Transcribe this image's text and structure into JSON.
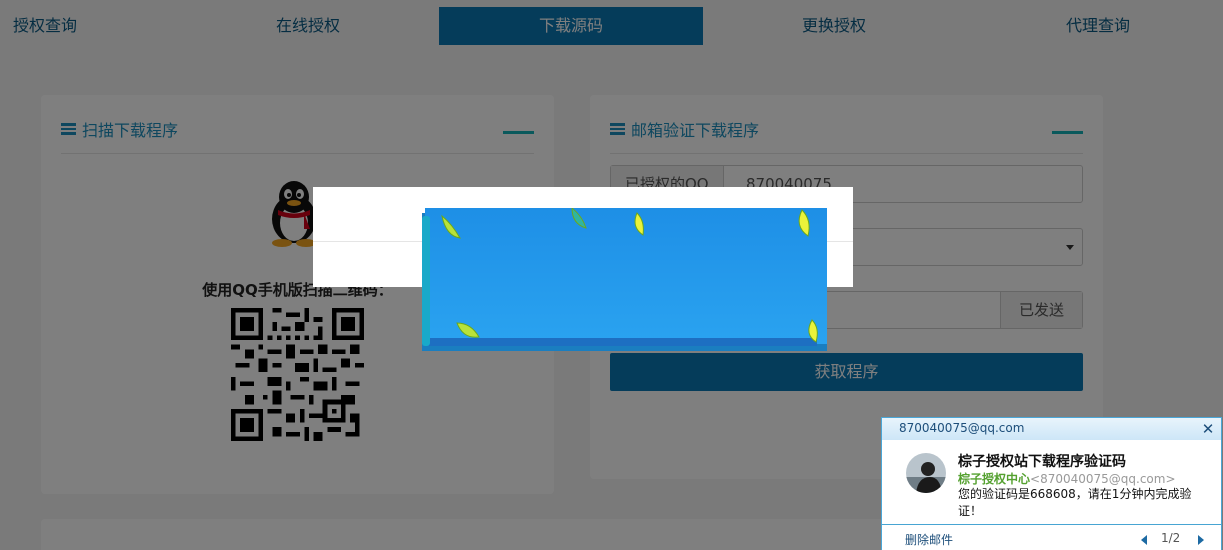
{
  "nav": {
    "tabs": [
      {
        "label": "授权查询",
        "active": false
      },
      {
        "label": "在线授权",
        "active": false
      },
      {
        "label": "下载源码",
        "active": true
      },
      {
        "label": "更换授权",
        "active": false
      },
      {
        "label": "代理查询",
        "active": false
      }
    ]
  },
  "scan_card": {
    "title": "扫描下载程序",
    "qr_label": "使用QQ手机版扫描二维码："
  },
  "email_card": {
    "title": "邮箱验证下载程序",
    "qq_field": {
      "label": "已授权的QQ",
      "value": "870040075"
    },
    "send_button": "已发送",
    "get_button": "获取程序"
  },
  "notification": {
    "from_email": "870040075@qq.com",
    "subject": "棕子授权站下载程序验证码",
    "sender_name": "棕子授权中心",
    "sender_email": "<870040075@qq.com>",
    "body": "您的验证码是668608，请在1分钟内完成验证！",
    "delete_label": "删除邮件",
    "pager": "1/2"
  },
  "icons": [
    "card-list-icon",
    "qq-penguin-icon",
    "qr-code",
    "close-icon",
    "dropdown-caret-icon",
    "prev-arrow-icon",
    "next-arrow-icon"
  ],
  "colors": {
    "accent": "#0b78b5",
    "title": "#1c8fbf",
    "dash": "#14b3b8",
    "sender": "#55a130"
  }
}
